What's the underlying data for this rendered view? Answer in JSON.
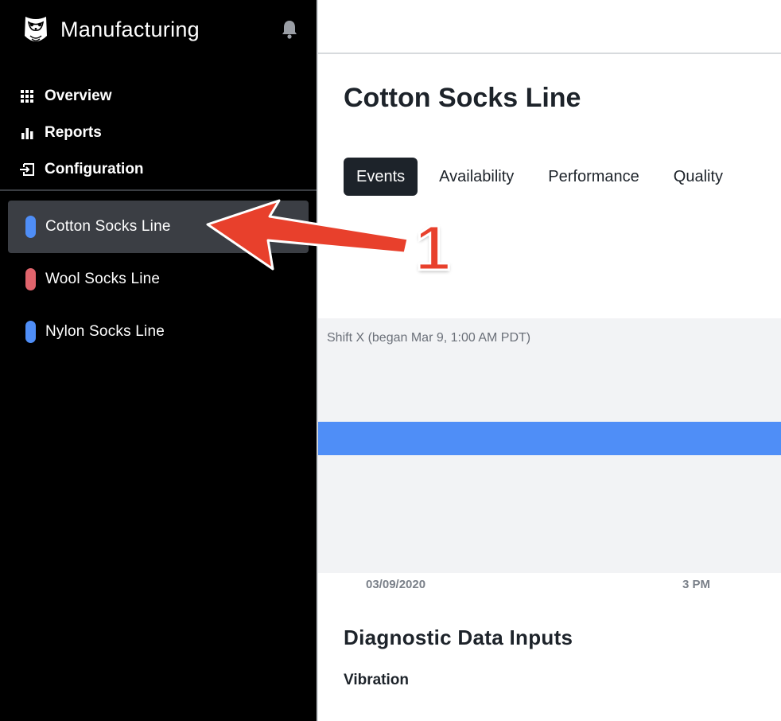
{
  "app": {
    "title": "Manufacturing"
  },
  "nav": {
    "items": [
      {
        "label": "Overview",
        "icon": "grid-icon"
      },
      {
        "label": "Reports",
        "icon": "bar-chart-icon"
      },
      {
        "label": "Configuration",
        "icon": "input-icon"
      }
    ]
  },
  "lines": {
    "items": [
      {
        "label": "Cotton Socks Line",
        "color": "#4f8ef7",
        "active": true
      },
      {
        "label": "Wool Socks Line",
        "color": "#e0646c",
        "active": false
      },
      {
        "label": "Nylon Socks Line",
        "color": "#4f8ef7",
        "active": false
      }
    ]
  },
  "main": {
    "title": "Cotton Socks Line",
    "tabs": [
      {
        "label": "Events",
        "active": true
      },
      {
        "label": "Availability",
        "active": false
      },
      {
        "label": "Performance",
        "active": false
      },
      {
        "label": "Quality",
        "active": false
      }
    ],
    "timeline": {
      "shift_label": "Shift X (began Mar 9, 1:00 AM PDT)",
      "bar_color": "#4f8ef7",
      "axis_labels": [
        "03/09/2020",
        "3 PM"
      ]
    },
    "section_title": "Diagnostic Data Inputs",
    "sub_title": "Vibration"
  },
  "annotation": {
    "number": "1",
    "color": "#e8402c"
  },
  "colors": {
    "sidebar_bg": "#000000",
    "active_item_bg": "#3b3e44",
    "active_tab_bg": "#1d232a",
    "accent_blue": "#4f8ef7"
  }
}
